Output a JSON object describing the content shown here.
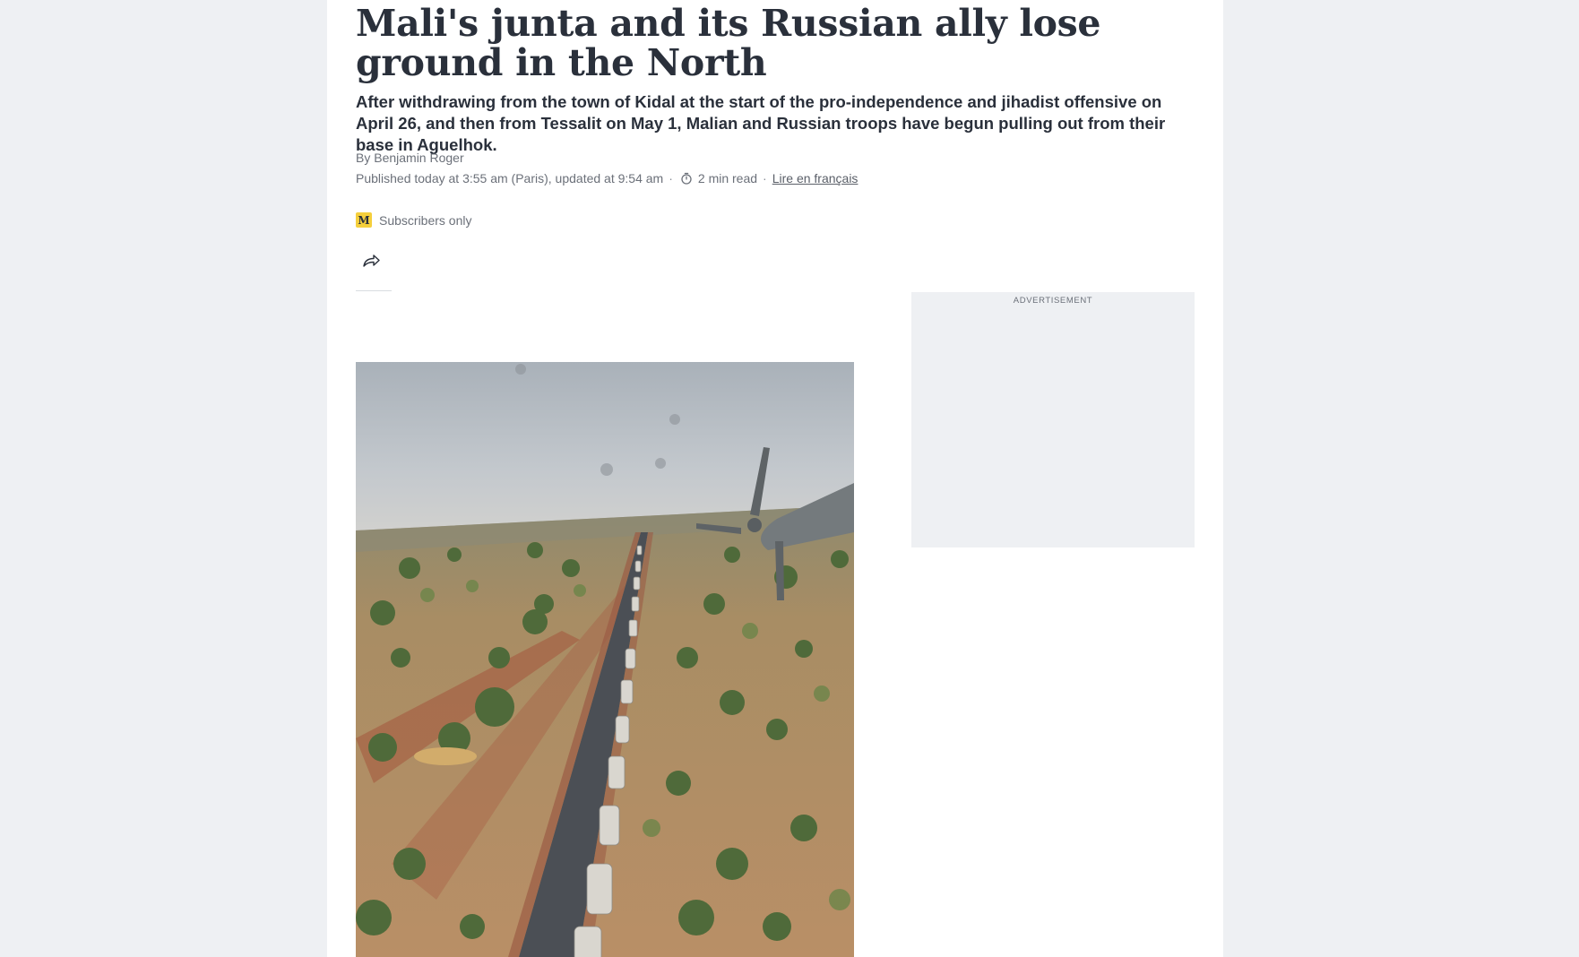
{
  "article": {
    "headline": "Mali's junta and its Russian ally lose ground in the North",
    "standfirst": "After withdrawing from the town of Kidal at the start of the pro-independence and jihadist offensive on April 26, and then from Tessalit on May 1, Malian and Russian troops have begun pulling out from their base in Aguelhok.",
    "byline": "By Benjamin Roger",
    "published": "Published today at 3:55 am (Paris), updated at 9:54 am",
    "separator": "·",
    "read_time": "2 min read",
    "lire_label": "Lire en français",
    "subscribers_label": "Subscribers only",
    "badge_letter": "M"
  },
  "sidebar": {
    "ad_label": "ADVERTISEMENT"
  },
  "photo": {
    "description_icon": "aerial-convoy-photo"
  },
  "icons": {
    "timer": "stopwatch-icon",
    "share": "share-arrow-icon",
    "badge": "le-monde-m-icon"
  },
  "colors": {
    "page_bg": "#eef0f3",
    "text": "#2a303b",
    "muted": "#6b7079",
    "badge": "#f5cf3c"
  }
}
